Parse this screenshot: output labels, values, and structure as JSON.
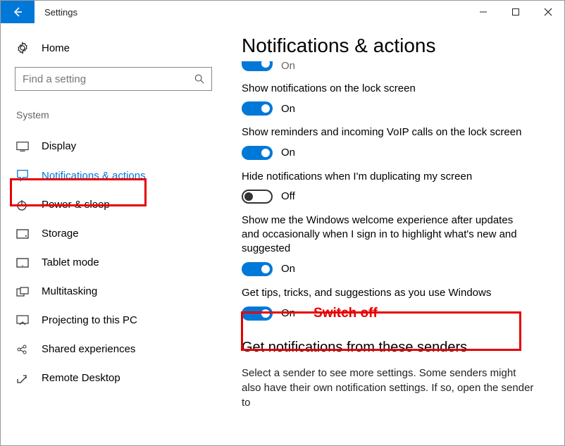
{
  "titlebar": {
    "title": "Settings"
  },
  "sidebar": {
    "home": "Home",
    "search_placeholder": "Find a setting",
    "group": "System",
    "items": [
      {
        "label": "Display"
      },
      {
        "label": "Notifications & actions"
      },
      {
        "label": "Power & sleep"
      },
      {
        "label": "Storage"
      },
      {
        "label": "Tablet mode"
      },
      {
        "label": "Multitasking"
      },
      {
        "label": "Projecting to this PC"
      },
      {
        "label": "Shared experiences"
      },
      {
        "label": "Remote Desktop"
      }
    ]
  },
  "main": {
    "heading": "Notifications & actions",
    "cutoff_state": "On",
    "settings": [
      {
        "desc": "Show notifications on the lock screen",
        "state": "On",
        "on": true
      },
      {
        "desc": "Show reminders and incoming VoIP calls on the lock screen",
        "state": "On",
        "on": true
      },
      {
        "desc": "Hide notifications when I'm duplicating my screen",
        "state": "Off",
        "on": false
      },
      {
        "desc": "Show me the Windows welcome experience after updates and occasionally when I sign in to highlight what's new and suggested",
        "state": "On",
        "on": true
      },
      {
        "desc": "Get tips, tricks, and suggestions as you use Windows",
        "state": "On",
        "on": true
      }
    ],
    "senders_heading": "Get notifications from these senders",
    "senders_body": "Select a sender to see more settings. Some senders might also have their own notification settings. If so, open the sender to"
  },
  "annotation": {
    "text": "Switch off"
  }
}
